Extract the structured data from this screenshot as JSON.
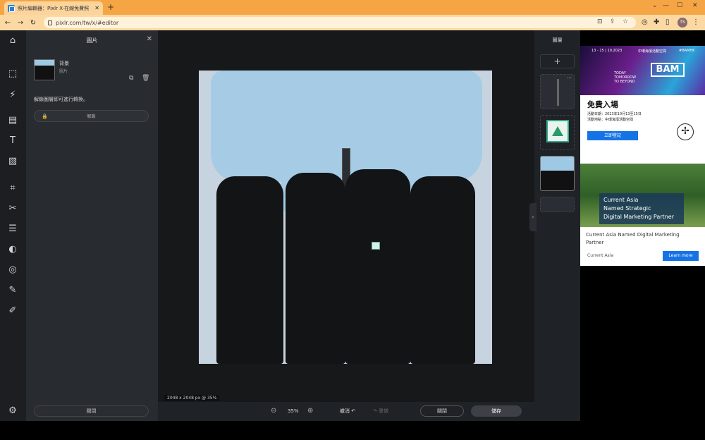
{
  "browser": {
    "tab_title": "照片編輯器：Pixlr X-在線免費照",
    "url": "pixlr.com/tw/x/#editor",
    "profile_initial": "TS"
  },
  "left_panel": {
    "title": "圖片",
    "layer_name": "背景",
    "layer_type": "圖片",
    "unlock_hint": "解鎖圖層即可進行轉換。",
    "unlock_label": "解鎖",
    "close_label": "關閉"
  },
  "canvas": {
    "size_label": "2048 x 2048 px @ 35%"
  },
  "bottom_bar": {
    "zoom": "35%",
    "undo_label": "撤消",
    "redo_label": "重做",
    "close_label": "關閉",
    "save_label": "儲存"
  },
  "right_panel": {
    "title": "圖層",
    "dots": "···"
  },
  "ads": {
    "ad1": {
      "top_text": "13 - 15 | 10.2023",
      "organizer": "中環海濱活動空間",
      "brand_tag": "#BAMHK",
      "today_text": "TODAY\nTOMORROW\nTO BEYOND",
      "bam": "BAM",
      "headline": "免費入場",
      "date_line": "活動日期：2023年10月13至15日",
      "venue_line": "活動地點：中環海濱活動空間",
      "cta": "立即登記"
    },
    "ad2": {
      "box_line1": "Current Asia",
      "box_line2": "Named Strategic",
      "box_line3": "Digital Marketing Partner",
      "title": "Current Asia Named Digital Marketing Partner",
      "brand": "Current Asia",
      "cta": "Learn more"
    }
  }
}
